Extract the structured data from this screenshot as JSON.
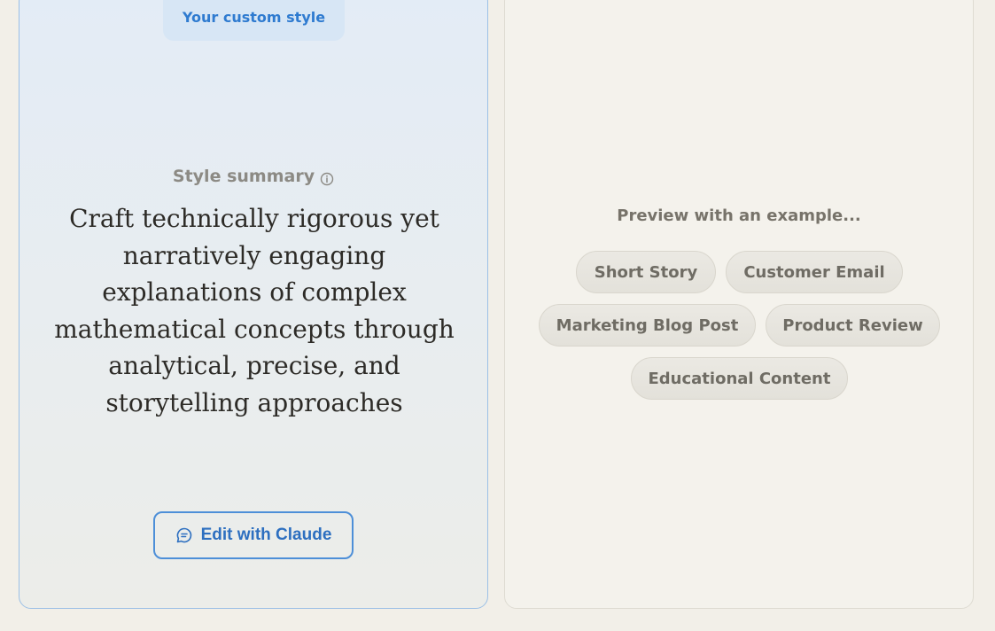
{
  "style_panel": {
    "custom_style_label": "Your custom style",
    "summary_label": "Style summary",
    "summary_text": "Craft technically rigorous yet narratively engaging explanations of complex mathematical concepts through analytical, precise, and storytelling approaches",
    "edit_button_label": "Edit with Claude",
    "accent_color": "#2f7bd0"
  },
  "preview_panel": {
    "title": "Preview with an example...",
    "examples": [
      "Short Story",
      "Customer Email",
      "Marketing Blog Post",
      "Product Review",
      "Educational Content"
    ]
  },
  "icons": {
    "info": "info-icon",
    "chat": "chat-bubble-icon"
  }
}
